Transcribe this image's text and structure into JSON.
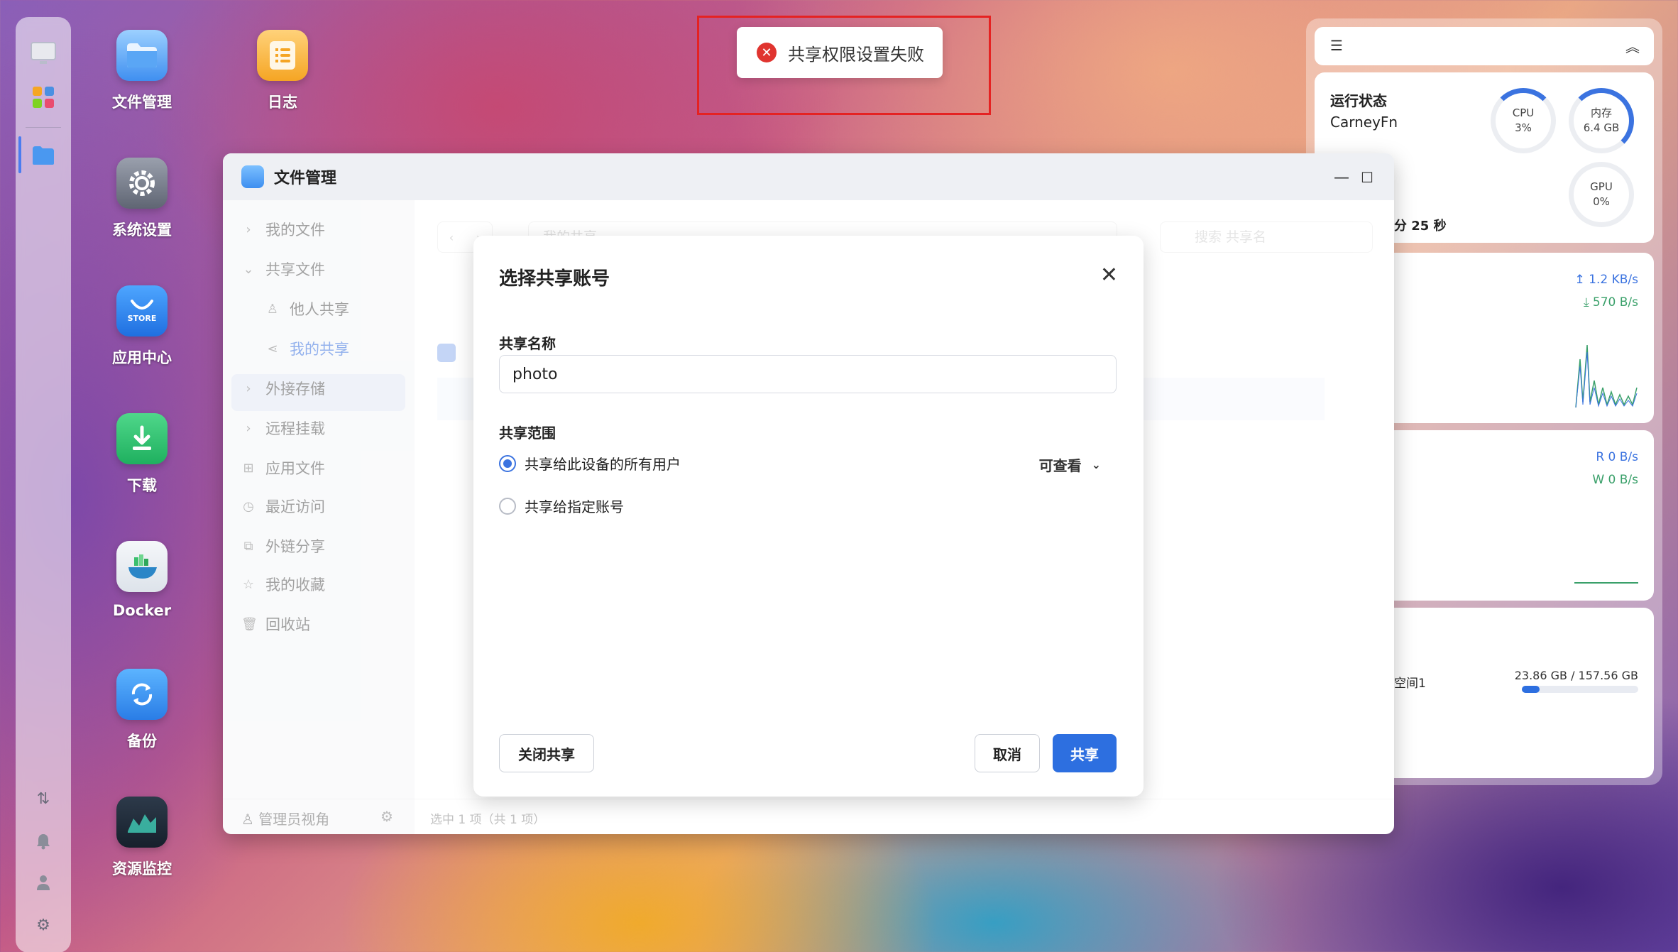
{
  "toast": {
    "message": "共享权限设置失败"
  },
  "desktop": {
    "icons": [
      {
        "label": "文件管理"
      },
      {
        "label": "日志"
      },
      {
        "label": "系统设置"
      },
      {
        "label": "应用中心",
        "sub": "STORE"
      },
      {
        "label": "下载"
      },
      {
        "label": "Docker"
      },
      {
        "label": "备份"
      },
      {
        "label": "资源监控"
      }
    ]
  },
  "file_manager": {
    "title": "文件管理",
    "sidebar": [
      {
        "label": "我的文件"
      },
      {
        "label": "共享文件"
      },
      {
        "label": "他人共享"
      },
      {
        "label": "我的共享"
      },
      {
        "label": "外接存储"
      },
      {
        "label": "远程挂载"
      },
      {
        "label": "应用文件"
      },
      {
        "label": "最近访问"
      },
      {
        "label": "外链分享"
      },
      {
        "label": "我的收藏"
      },
      {
        "label": "回收站"
      }
    ],
    "path_placeholder": "我的共享",
    "search_placeholder": "搜索 共享名",
    "footer_user": "管理员视角",
    "footer_status": "选中 1 项（共 1 项）"
  },
  "dialog": {
    "title": "选择共享账号",
    "name_label": "共享名称",
    "name_value": "photo",
    "scope_label": "共享范围",
    "option_all": "共享给此设备的所有用户",
    "option_specific": "共享给指定账号",
    "selected_option": "all",
    "permission": "可查看",
    "close_share_button": "关闭共享",
    "cancel_button": "取消",
    "share_button": "共享"
  },
  "widgets": {
    "status": {
      "title": "运行状态",
      "device": "CarneyFn",
      "uptime_tail": "分 25 秒",
      "cpu_label": "CPU",
      "cpu_value": "3%",
      "mem_label": "内存",
      "mem_value": "6.4 GB",
      "gpu_label": "GPU",
      "gpu_value": "0%"
    },
    "network": {
      "up": "1.2 KB/s",
      "down": "570 B/s"
    },
    "disk_io": {
      "read": "R  0 B/s",
      "write": "W  0 B/s"
    },
    "storage": {
      "name": "空间1",
      "usage": "23.86 GB / 157.56 GB",
      "used_fraction": 0.15
    }
  },
  "colors": {
    "accent": "#2d6fe0",
    "error": "#e0342f",
    "highlight_border": "#e52222"
  }
}
